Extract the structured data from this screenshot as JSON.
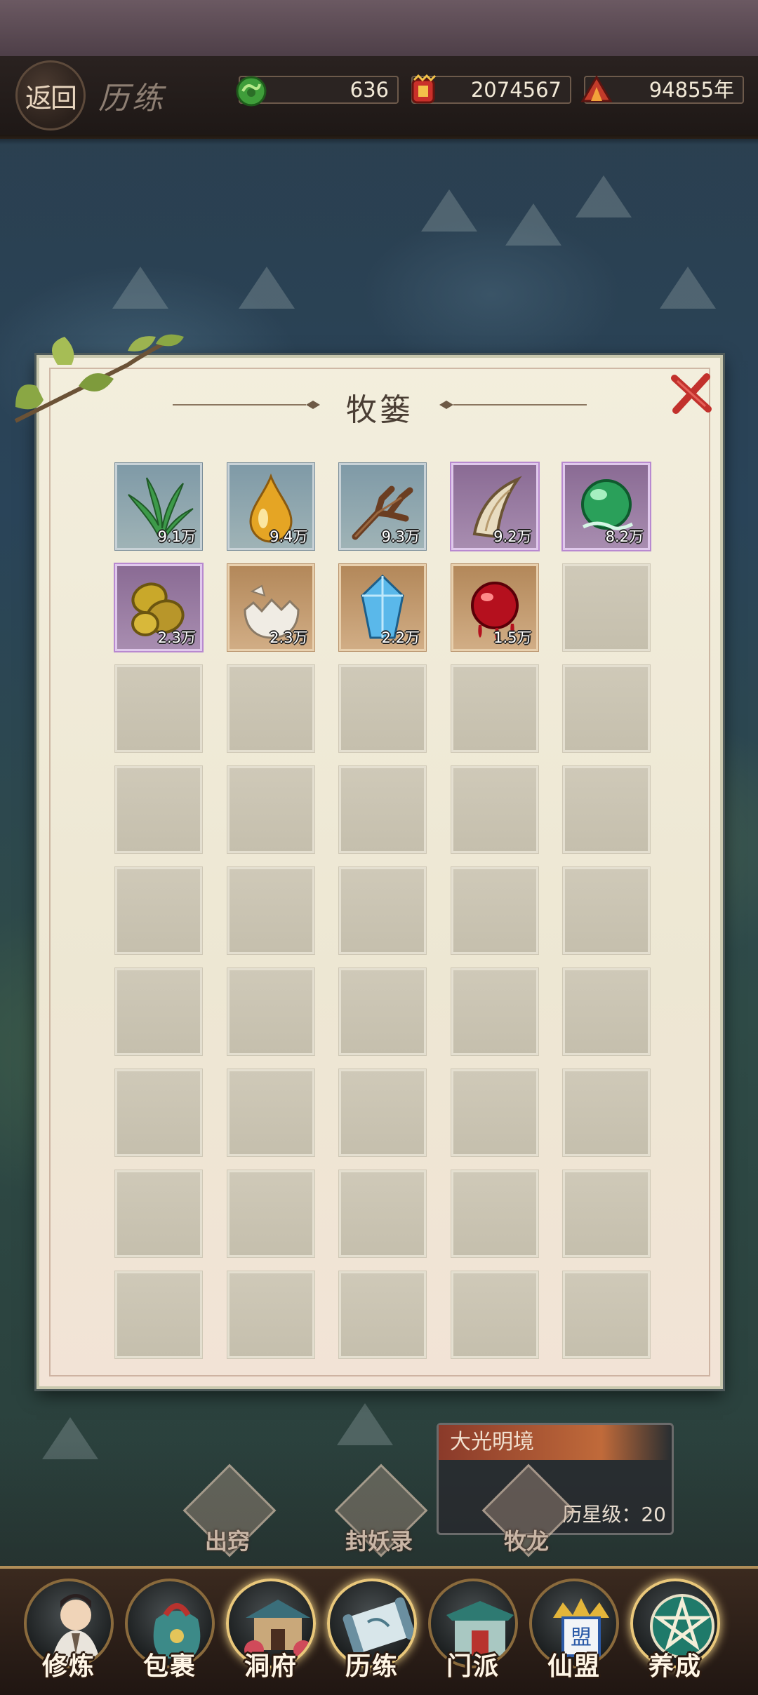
{
  "header": {
    "back_label": "返回",
    "title": "历练",
    "resources": [
      {
        "icon": "jade-dragon-icon",
        "value": "636"
      },
      {
        "icon": "spirit-coin-pouch-icon",
        "value": "2074567"
      },
      {
        "icon": "lifespan-incense-icon",
        "value": "94855年"
      }
    ]
  },
  "dialog": {
    "title": "牧篓",
    "close_icon": "close-x-icon",
    "items": [
      {
        "name": "spirit-grass",
        "quality": "blue",
        "qty": "9.1万"
      },
      {
        "name": "golden-oil-drop",
        "quality": "blue",
        "qty": "9.4万"
      },
      {
        "name": "ancient-branch",
        "quality": "blue",
        "qty": "9.3万"
      },
      {
        "name": "beast-fang",
        "quality": "purple",
        "qty": "9.2万"
      },
      {
        "name": "jade-orb",
        "quality": "purple",
        "qty": "8.2万"
      },
      {
        "name": "golden-scales",
        "quality": "purple",
        "qty": "2.3万"
      },
      {
        "name": "broken-eggshell",
        "quality": "orange",
        "qty": "2.3万"
      },
      {
        "name": "ice-crystal",
        "quality": "orange",
        "qty": "2.2万"
      },
      {
        "name": "blood-pearl",
        "quality": "orange",
        "qty": "1.5万"
      }
    ],
    "total_slots": 45
  },
  "map": {
    "card_title": "大光明境",
    "star_level": "历星级：20"
  },
  "modes": [
    {
      "label": "出窍"
    },
    {
      "label": "封妖录"
    },
    {
      "label": "牧龙"
    }
  ],
  "nav": [
    {
      "label": "修炼",
      "icon": "cultivator-portrait-icon"
    },
    {
      "label": "包裹",
      "icon": "bag-icon"
    },
    {
      "label": "洞府",
      "icon": "cave-mansion-icon"
    },
    {
      "label": "历练",
      "icon": "scroll-map-icon"
    },
    {
      "label": "门派",
      "icon": "sect-gate-icon"
    },
    {
      "label": "仙盟",
      "icon": "alliance-crown-icon"
    },
    {
      "label": "养成",
      "icon": "pentagram-icon"
    }
  ],
  "colors": {
    "header_bg": "#1e1816",
    "dialog_bg": "#f3eedd",
    "quality_blue": "#8ea6b0",
    "quality_purple": "#a88db0",
    "quality_orange": "#c9a178",
    "close_red": "#c2312c"
  }
}
